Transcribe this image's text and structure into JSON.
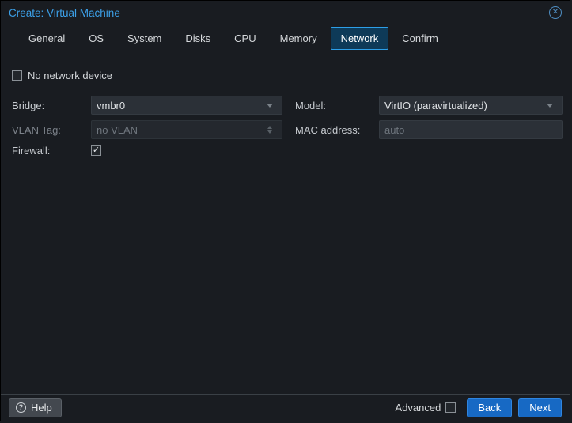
{
  "window": {
    "title": "Create: Virtual Machine"
  },
  "icons": {
    "close": "circle-x",
    "close_glyph": "✕",
    "bridge_dropdown": "chevron-down",
    "model_dropdown": "chevron-down",
    "vlan_spinner": "up-down-spinner",
    "help": "question-circle",
    "help_glyph": "?",
    "check_glyph": "✓"
  },
  "tabs": [
    {
      "label": "General",
      "active": false
    },
    {
      "label": "OS",
      "active": false
    },
    {
      "label": "System",
      "active": false
    },
    {
      "label": "Disks",
      "active": false
    },
    {
      "label": "CPU",
      "active": false
    },
    {
      "label": "Memory",
      "active": false
    },
    {
      "label": "Network",
      "active": true
    },
    {
      "label": "Confirm",
      "active": false
    }
  ],
  "form": {
    "no_network_device": {
      "label": "No network device",
      "checked": false
    },
    "bridge": {
      "label": "Bridge:",
      "value": "vmbr0"
    },
    "vlan_tag": {
      "label": "VLAN Tag:",
      "placeholder": "no VLAN",
      "disabled": true
    },
    "firewall": {
      "label": "Firewall:",
      "checked": true
    },
    "model": {
      "label": "Model:",
      "value": "VirtIO (paravirtualized)"
    },
    "mac_address": {
      "label": "MAC address:",
      "placeholder": "auto"
    }
  },
  "footer": {
    "help_label": "Help",
    "advanced_label": "Advanced",
    "advanced_checked": false,
    "back_label": "Back",
    "next_label": "Next"
  },
  "colors": {
    "background": "#191c21",
    "title": "#3ca0e8",
    "tab_active_border": "#2d9fe8",
    "tab_active_bg": "#0e3a58",
    "field_bg": "#2b3037",
    "button_primary": "#1769c4",
    "divider": "#3a4046",
    "placeholder_text": "#6e757d"
  }
}
